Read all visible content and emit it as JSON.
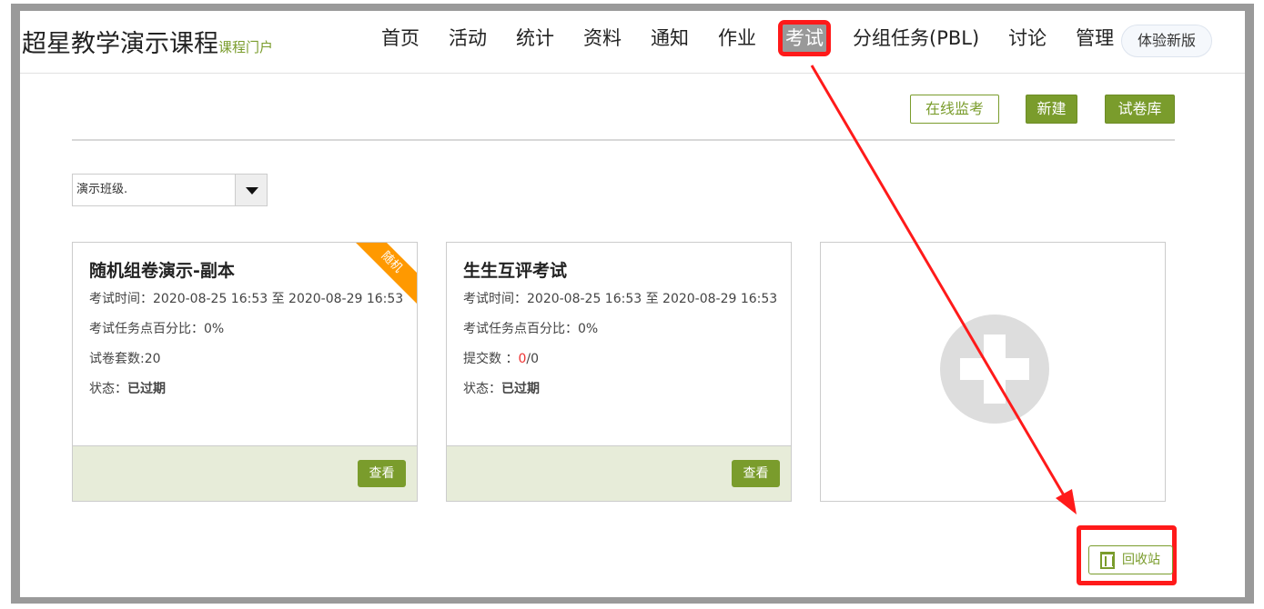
{
  "header": {
    "course_title": "超星教学演示课程",
    "portal_link": "课程门户",
    "nav": [
      "首页",
      "活动",
      "统计",
      "资料",
      "通知",
      "作业",
      "考试",
      "分组任务(PBL)",
      "讨论",
      "管理"
    ],
    "active_nav": "考试",
    "new_version": "体验新版"
  },
  "toolbar": {
    "monitor": "在线监考",
    "create": "新建",
    "paper_bank": "试卷库"
  },
  "class_select": {
    "value": "演示班级."
  },
  "cards": [
    {
      "title": "随机组卷演示-副本",
      "badge": "随机",
      "time": "考试时间：2020-08-25 16:53 至 2020-08-29 16:53",
      "percent": "考试任务点百分比：0%",
      "extra_label": "试卷套数:20",
      "status_label": "状态：",
      "status": "已过期",
      "view": "查看"
    },
    {
      "title": "生生互评考试",
      "time": "考试时间：2020-08-25 16:53 至 2020-08-29 16:53",
      "percent": "考试任务点百分比：0%",
      "extra_label": "提交数 ：",
      "extra_value": "0",
      "extra_tail": "/0",
      "status_label": "状态：",
      "status": "已过期",
      "view": "查看"
    }
  ],
  "recycle": "回收站",
  "colors": {
    "accent": "#7a9c2c",
    "highlight": "#ff1a1a",
    "badge": "#ff9900"
  }
}
